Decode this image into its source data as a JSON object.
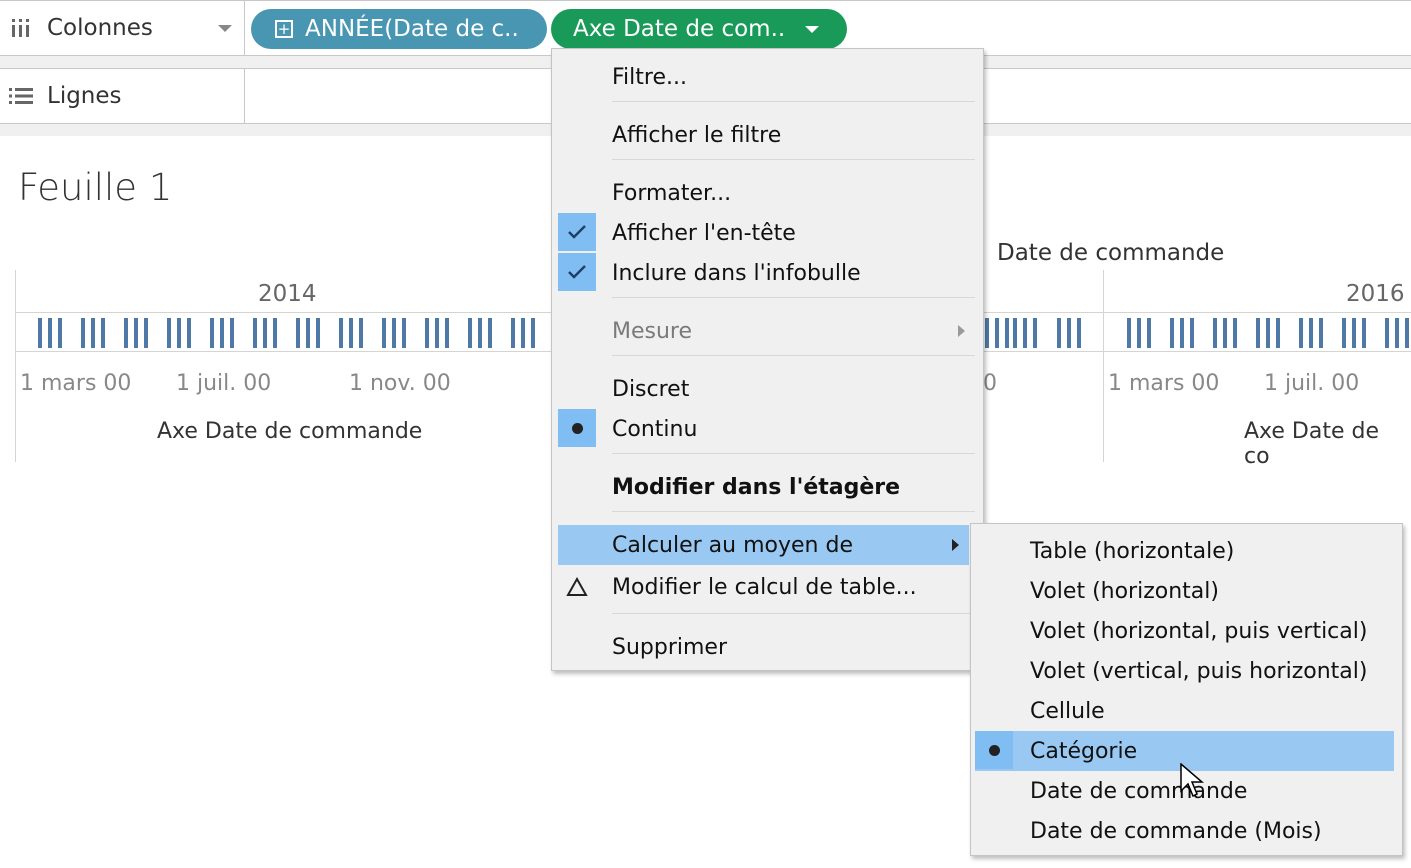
{
  "shelves": {
    "columns_label": "Colonnes",
    "rows_label": "Lignes",
    "pill_year": "ANNÉE(Date de c..",
    "pill_axis": "Axe Date de com.."
  },
  "sheet": {
    "title": "Feuille 1",
    "header_field": "Date de commande",
    "years": [
      "2014",
      "2016"
    ],
    "tick_labels_left": [
      "1 mars 00",
      "1 juil. 00",
      "1 nov. 00"
    ],
    "tick_label_partial": "0",
    "tick_labels_right": [
      "1 mars 00",
      "1 juil. 00"
    ],
    "axis_title": "Axe Date de commande",
    "axis_title_partial": "Axe Date de co"
  },
  "context_menu": {
    "filter": "Filtre...",
    "show_filter": "Afficher le filtre",
    "format": "Formater...",
    "show_header": "Afficher l'en-tête",
    "include_tooltip": "Inclure dans l'infobulle",
    "measure": "Mesure",
    "discrete": "Discret",
    "continuous": "Continu",
    "edit_in_shelf": "Modifier dans l'étagère",
    "compute_using": "Calculer au moyen de",
    "edit_table_calc": "Modifier le calcul de table...",
    "delete": "Supprimer"
  },
  "submenu": {
    "items": [
      "Table (horizontale)",
      "Volet (horizontal)",
      "Volet (horizontal, puis vertical)",
      "Volet (vertical, puis horizontal)",
      "Cellule",
      "Catégorie",
      "Date de commande",
      "Date de commande (Mois)"
    ],
    "selected": "Catégorie"
  },
  "colors": {
    "pill_year": "#4996b2",
    "pill_axis": "#1a9a59",
    "bar": "#4e79a7",
    "menu_highlight": "#99c9f2",
    "check_bg": "#7fbdf2"
  }
}
